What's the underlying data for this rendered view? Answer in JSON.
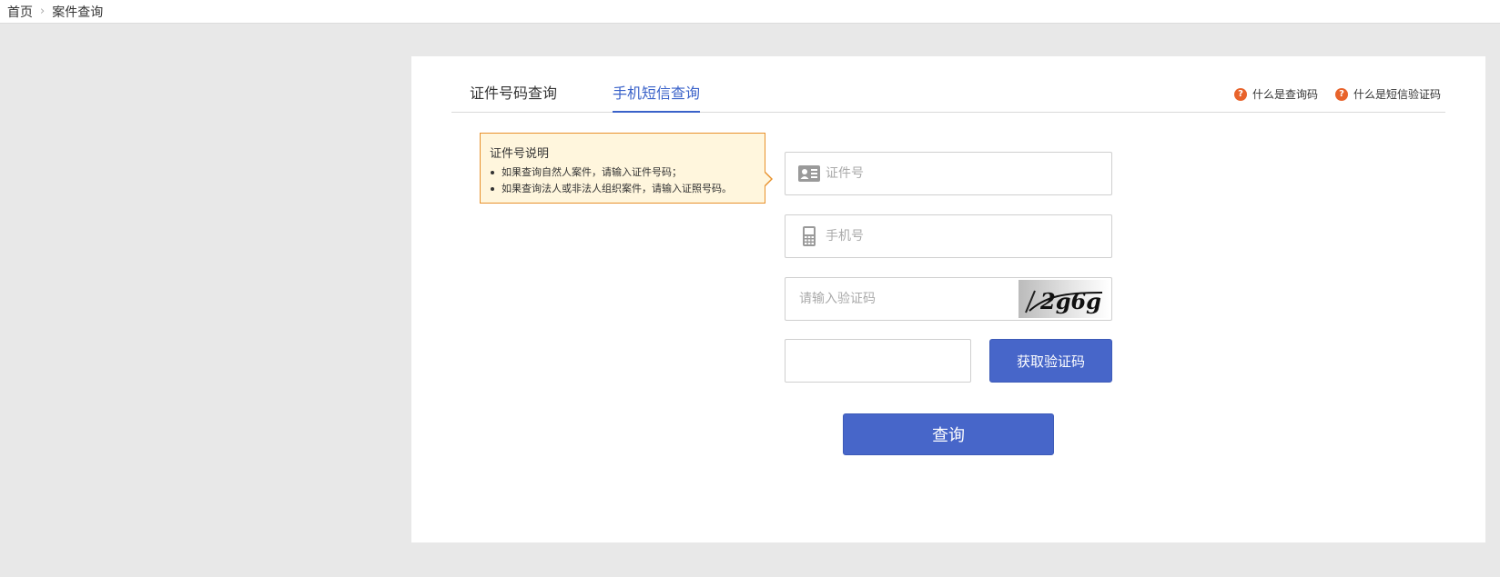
{
  "breadcrumb": {
    "home": "首页",
    "current": "案件查询"
  },
  "tabs": [
    {
      "label": "证件号码查询"
    },
    {
      "label": "手机短信查询"
    }
  ],
  "help_links": [
    {
      "label": "什么是查询码",
      "icon": "question-icon"
    },
    {
      "label": "什么是短信验证码",
      "icon": "question-icon"
    }
  ],
  "tip": {
    "title": "证件号说明",
    "items": [
      "如果查询自然人案件，请输入证件号码；",
      "如果查询法人或非法人组织案件，请输入证照号码。"
    ]
  },
  "form": {
    "id_placeholder": "证件号",
    "phone_placeholder": "手机号",
    "captcha_placeholder": "请输入验证码",
    "captcha_text": "2g6g",
    "sms_value": "",
    "sms_button": "获取验证码",
    "submit_button": "查询"
  },
  "colors": {
    "accent": "#4766c9",
    "tip_border": "#e8912b",
    "tip_bg": "#fff6dd",
    "help_icon": "#e8632b"
  }
}
